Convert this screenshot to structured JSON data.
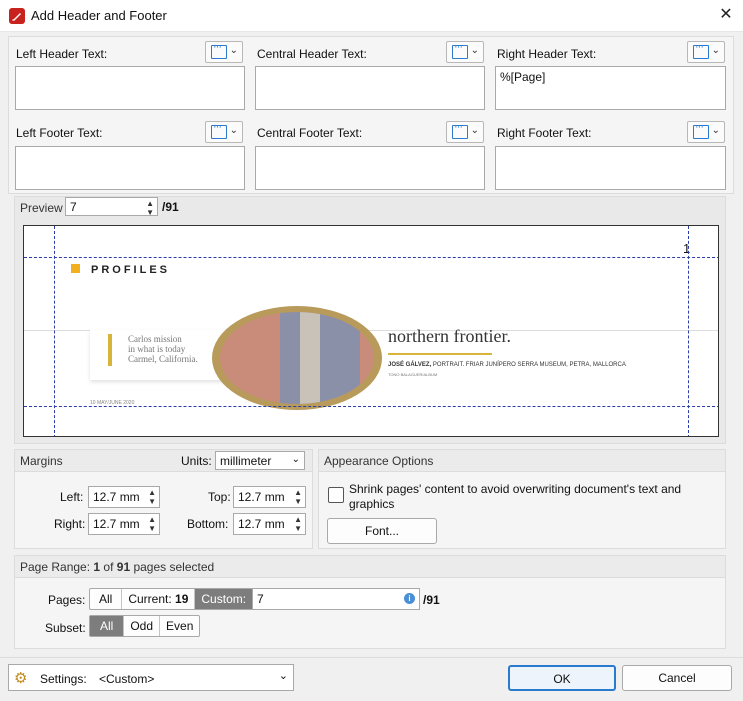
{
  "window": {
    "title": "Add Header and Footer",
    "close_glyph": "✕"
  },
  "header_footer": {
    "left_header_label": "Left Header Text:",
    "central_header_label": "Central Header Text:",
    "right_header_label": "Right Header Text:",
    "left_footer_label": "Left Footer Text:",
    "central_footer_label": "Central Footer Text:",
    "right_footer_label": "Right Footer Text:",
    "left_header_value": "",
    "central_header_value": "",
    "right_header_value": "%[Page]",
    "left_footer_value": "",
    "central_footer_value": "",
    "right_footer_value": ""
  },
  "preview": {
    "label": "Preview",
    "page_value": "7",
    "total": "/91",
    "page_number_shown": "1",
    "doc": {
      "section": "PROFILES",
      "quote": "Carlos mission\nin what is today\nCarmel, California.",
      "headline": "northern frontier.",
      "caption_bold": "JOSÉ GÁLVEZ,",
      "caption_rest": " PORTRAIT. FRIAR JUNÍPERO SERRA MUSEUM, PETRA, MALLORCA",
      "caption_small": "TONO BALAGUER/ALBUM",
      "footer_left": "10  MAY/JUNE 2020"
    }
  },
  "margins": {
    "title": "Margins",
    "units_label": "Units:",
    "units_value": "millimeter",
    "left_label": "Left:",
    "left_value": "12.7 mm",
    "top_label": "Top:",
    "top_value": "12.7 mm",
    "right_label": "Right:",
    "right_value": "12.7 mm",
    "bottom_label": "Bottom:",
    "bottom_value": "12.7 mm"
  },
  "appearance": {
    "title": "Appearance Options",
    "shrink_label": "Shrink pages' content to avoid overwriting document's text and graphics",
    "shrink_checked": false,
    "font_button": "Font..."
  },
  "page_range": {
    "title_prefix": "Page Range: ",
    "current": "1",
    "of": " of ",
    "total": "91",
    "suffix": " pages selected",
    "pages_label": "Pages:",
    "all": "All",
    "current_label": "Current: ",
    "current_value": "19",
    "custom": "Custom:",
    "custom_value": "7",
    "custom_total": "/91",
    "subset_label": "Subset:",
    "subset_options": [
      "All",
      "Odd",
      "Even"
    ],
    "subset_selected": "All"
  },
  "footer": {
    "settings_label": "Settings:",
    "settings_value": "<Custom>",
    "ok": "OK",
    "cancel": "Cancel"
  },
  "colors": {
    "accent": "#2a7ad0",
    "guide": "#2b3ea8",
    "title_icon": "#c8221e",
    "profile_square": "#f2b01e"
  }
}
